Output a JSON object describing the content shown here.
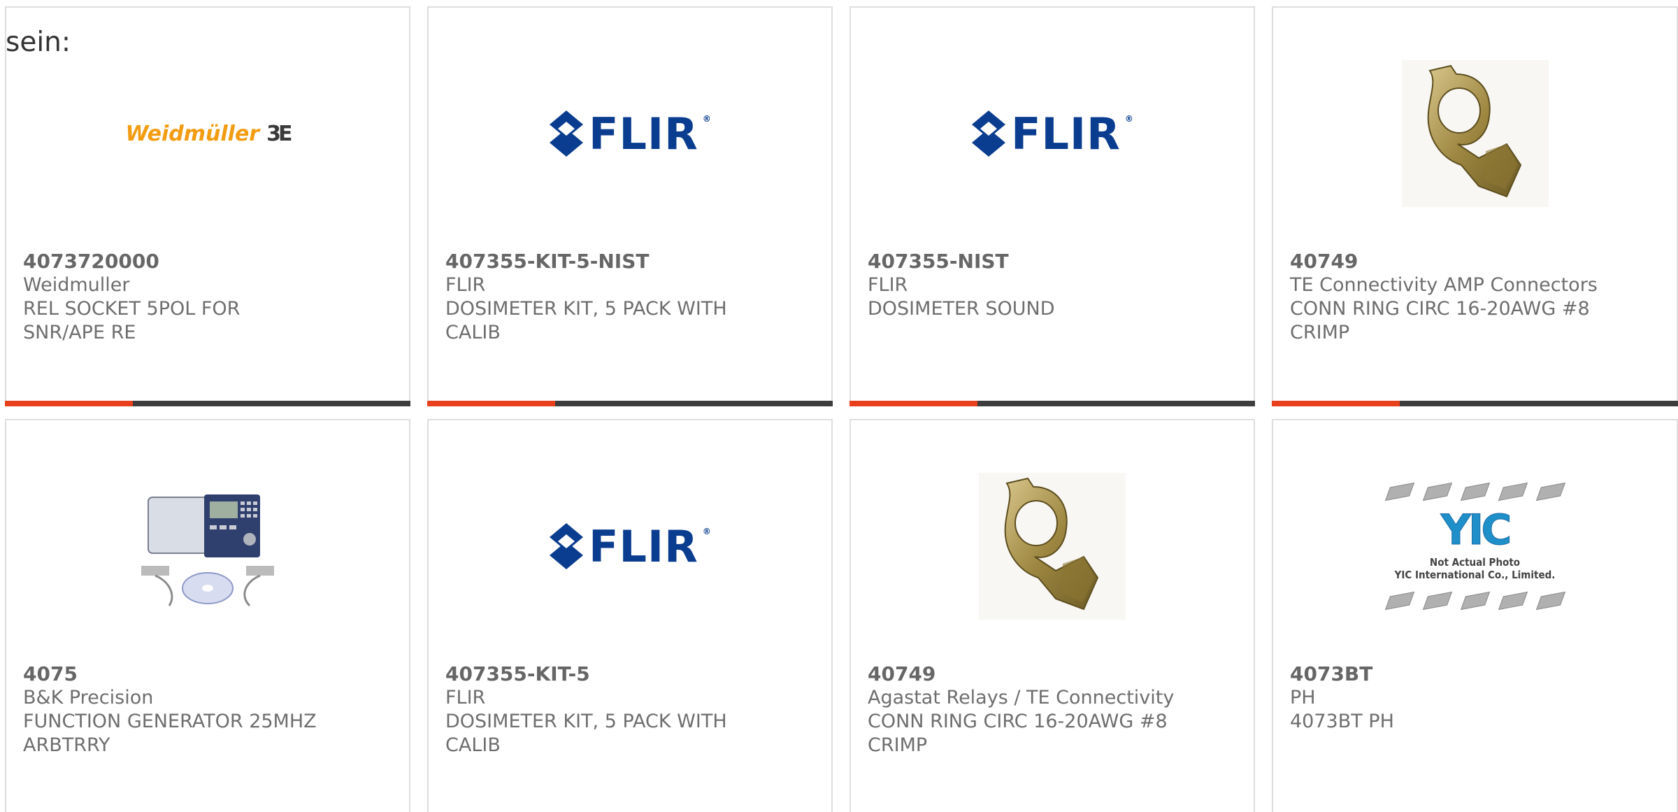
{
  "header": {
    "partial_text": "sein:"
  },
  "colors": {
    "card_border": "#dedede",
    "bar_dark": "#3d3d3d",
    "bar_accent": "#e8401c",
    "flir_blue": "#0a3d8f",
    "weidmuller_orange": "#f39c12"
  },
  "products": [
    {
      "part_number": "4073720000",
      "manufacturer": "Weidmuller",
      "description": "REL SOCKET 5POL FOR SNR/APE RE",
      "image": "weidmuller-logo",
      "logo_text": "Weidmüller",
      "logo_symbol": "3E"
    },
    {
      "part_number": "407355-KIT-5-NIST",
      "manufacturer": "FLIR",
      "description": "DOSIMETER KIT, 5 PACK WITH CALIB",
      "image": "flir-logo",
      "logo_text": "FLIR"
    },
    {
      "part_number": "407355-NIST",
      "manufacturer": "FLIR",
      "description": "DOSIMETER SOUND",
      "image": "flir-logo",
      "logo_text": "FLIR"
    },
    {
      "part_number": "40749",
      "manufacturer": "TE Connectivity AMP Connectors",
      "description": "CONN RING CIRC 16-20AWG #8 CRIMP",
      "image": "ring-terminal-photo"
    },
    {
      "part_number": "4075",
      "manufacturer": "B&K Precision",
      "description": "FUNCTION GENERATOR 25MHZ ARBTRRY",
      "image": "function-generator-photo"
    },
    {
      "part_number": "407355-KIT-5",
      "manufacturer": "FLIR",
      "description": "DOSIMETER KIT, 5 PACK WITH CALIB",
      "image": "flir-logo",
      "logo_text": "FLIR"
    },
    {
      "part_number": "40749",
      "manufacturer": "Agastat Relays / TE Connectivity",
      "description": "CONN RING CIRC 16-20AWG #8 CRIMP",
      "image": "ring-terminal-photo"
    },
    {
      "part_number": "4073BT",
      "manufacturer": "PH",
      "description": "4073BT PH",
      "image": "yic-placeholder",
      "logo_text": "YIC",
      "placeholder_line1": "Not Actual Photo",
      "placeholder_line2": "YIC International Co., Limited."
    }
  ]
}
